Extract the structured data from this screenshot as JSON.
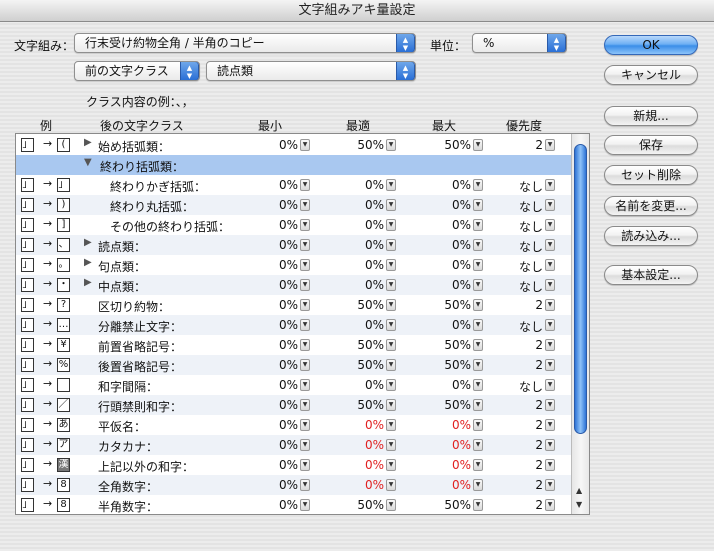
{
  "window": {
    "title": "文字組みアキ量設定"
  },
  "form": {
    "mojikumi_label": "文字組み：",
    "mojikumi_value": "行末受け約物全角 / 半角のコピー",
    "unit_label": "単位：",
    "unit_value": "%",
    "prev_class_value": "前の文字クラス",
    "class_value": "読点類",
    "example_label": "クラス内容の例：、，"
  },
  "buttons": {
    "ok": "OK",
    "cancel": "キャンセル",
    "new": "新規...",
    "save": "保存",
    "delete": "セット削除",
    "rename": "名前を変更...",
    "load": "読み込み...",
    "basic": "基本設定..."
  },
  "table": {
    "headers": {
      "example": "例",
      "next_class": "後の文字クラス",
      "min": "最小",
      "opt": "最適",
      "max": "最大",
      "priority": "優先度"
    },
    "rows": [
      {
        "glyph": "(",
        "name": "始め括弧類：",
        "tri": "▶",
        "min": "0%",
        "opt": "50%",
        "max": "50%",
        "pri": "2"
      },
      {
        "glyph": "",
        "name": "終わり括弧類：",
        "tri": "▼",
        "section": true
      },
      {
        "glyph": "」",
        "name": "終わりかぎ括弧：",
        "min": "0%",
        "opt": "0%",
        "max": "0%",
        "pri": "なし"
      },
      {
        "glyph": ")",
        "name": "終わり丸括弧：",
        "min": "0%",
        "opt": "0%",
        "max": "0%",
        "pri": "なし"
      },
      {
        "glyph": "]",
        "name": "その他の終わり括弧：",
        "min": "0%",
        "opt": "0%",
        "max": "0%",
        "pri": "なし"
      },
      {
        "glyph": "、",
        "name": "読点類：",
        "tri": "▶",
        "min": "0%",
        "opt": "0%",
        "max": "0%",
        "pri": "なし"
      },
      {
        "glyph": "。",
        "name": "句点類：",
        "tri": "▶",
        "min": "0%",
        "opt": "0%",
        "max": "0%",
        "pri": "なし"
      },
      {
        "glyph": "・",
        "name": "中点類：",
        "tri": "▶",
        "min": "0%",
        "opt": "0%",
        "max": "0%",
        "pri": "なし"
      },
      {
        "glyph": "?",
        "name": "区切り約物：",
        "min": "0%",
        "opt": "50%",
        "max": "50%",
        "pri": "2"
      },
      {
        "glyph": "…",
        "name": "分離禁止文字：",
        "min": "0%",
        "opt": "0%",
        "max": "0%",
        "pri": "なし"
      },
      {
        "glyph": "¥",
        "name": "前置省略記号：",
        "min": "0%",
        "opt": "50%",
        "max": "50%",
        "pri": "2"
      },
      {
        "glyph": "%",
        "name": "後置省略記号：",
        "min": "0%",
        "opt": "50%",
        "max": "50%",
        "pri": "2"
      },
      {
        "glyph": "",
        "name": "和字間隔：",
        "min": "0%",
        "opt": "0%",
        "max": "0%",
        "pri": "なし"
      },
      {
        "glyph": "／",
        "name": "行頭禁則和字：",
        "min": "0%",
        "opt": "50%",
        "max": "50%",
        "pri": "2"
      },
      {
        "glyph": "あ",
        "name": "平仮名：",
        "min": "0%",
        "opt": "0%",
        "max": "0%",
        "pri": "2",
        "red": true
      },
      {
        "glyph": "ア",
        "name": "カタカナ：",
        "min": "0%",
        "opt": "0%",
        "max": "0%",
        "pri": "2",
        "red": true
      },
      {
        "glyph": "漢",
        "name": "上記以外の和字：",
        "min": "0%",
        "opt": "0%",
        "max": "0%",
        "pri": "2",
        "red": true,
        "dark": true
      },
      {
        "glyph": "8",
        "name": "全角数字：",
        "min": "0%",
        "opt": "0%",
        "max": "0%",
        "pri": "2",
        "red": true
      },
      {
        "glyph": "8",
        "name": "半角数字：",
        "min": "0%",
        "opt": "50%",
        "max": "50%",
        "pri": "2"
      }
    ]
  }
}
